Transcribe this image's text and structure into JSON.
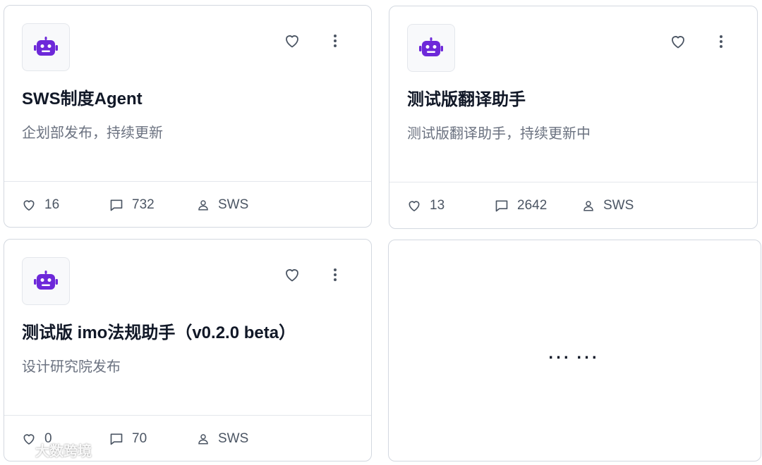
{
  "cards": [
    {
      "title": "SWS制度Agent",
      "description": "企划部发布，持续更新",
      "likes": "16",
      "comments": "732",
      "author": "SWS"
    },
    {
      "title": "测试版翻译助手",
      "description": "测试版翻译助手，持续更新中",
      "likes": "13",
      "comments": "2642",
      "author": "SWS"
    },
    {
      "title": "测试版 imo法规助手（v0.2.0 beta）",
      "description": "设计研究院发布",
      "likes": "0",
      "comments": "70",
      "author": "SWS"
    }
  ],
  "placeholder_card": {
    "text": "……"
  },
  "watermark": {
    "text": "大数跨境"
  },
  "colors": {
    "robot_icon": "#6d28d9",
    "card_border": "#d3d8e0",
    "title": "#111827",
    "description": "#6b7280",
    "stat_text": "#4b5563"
  }
}
